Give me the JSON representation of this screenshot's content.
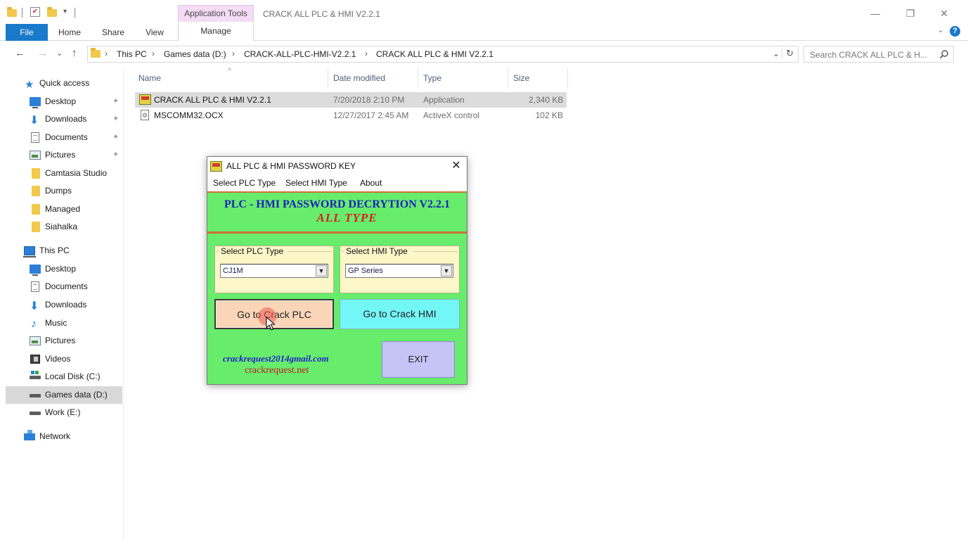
{
  "window": {
    "title": "CRACK ALL PLC & HMI V2.2.1",
    "context_tab": "Application Tools",
    "minimize_glyph": "—",
    "restore_glyph": "❐",
    "close_glyph": "✕"
  },
  "ribbon": {
    "tabs": [
      "File",
      "Home",
      "Share",
      "View",
      "Manage"
    ],
    "help_glyph": "?",
    "expand_glyph": "⌄"
  },
  "nav": {
    "back_glyph": "←",
    "forward_glyph": "→",
    "recent_glyph": "⌄",
    "up_glyph": "↑",
    "breadcrumb": [
      "This PC",
      "Games data (D:)",
      "CRACK-ALL-PLC-HMI-V2.2.1",
      "CRACK ALL PLC & HMI V2.2.1"
    ],
    "chevron": "›",
    "dropdown_glyph": "⌄",
    "refresh_glyph": "↻",
    "search_placeholder": "Search CRACK ALL PLC & H..."
  },
  "sidebar": {
    "quick_access": "Quick access",
    "pin_glyph": "📌",
    "items": [
      {
        "label": "Desktop",
        "icon": "desktop-icon",
        "pinned": true
      },
      {
        "label": "Downloads",
        "icon": "downloads-icon",
        "pinned": true
      },
      {
        "label": "Documents",
        "icon": "documents-icon",
        "pinned": true
      },
      {
        "label": "Pictures",
        "icon": "pictures-icon",
        "pinned": true
      },
      {
        "label": "Camtasia Studio",
        "icon": "folder-icon",
        "pinned": false
      },
      {
        "label": "Dumps",
        "icon": "folder-icon",
        "pinned": false
      },
      {
        "label": "Managed",
        "icon": "folder-icon",
        "pinned": false
      },
      {
        "label": "Siahalka",
        "icon": "folder-icon",
        "pinned": false
      }
    ],
    "this_pc": "This PC",
    "pc_items": [
      {
        "label": "Desktop",
        "icon": "desktop-icon"
      },
      {
        "label": "Documents",
        "icon": "documents-icon"
      },
      {
        "label": "Downloads",
        "icon": "downloads-icon"
      },
      {
        "label": "Music",
        "icon": "music-icon"
      },
      {
        "label": "Pictures",
        "icon": "pictures-icon"
      },
      {
        "label": "Videos",
        "icon": "videos-icon"
      },
      {
        "label": "Local Disk (C:)",
        "icon": "local-disk-icon"
      },
      {
        "label": "Games data (D:)",
        "icon": "drive-icon",
        "selected": true
      },
      {
        "label": "Work (E:)",
        "icon": "drive-icon"
      }
    ],
    "network": "Network"
  },
  "filelist": {
    "columns": [
      "Name",
      "Date modified",
      "Type",
      "Size"
    ],
    "sort_glyph": "^",
    "rows": [
      {
        "name": "CRACK ALL PLC & HMI V2.2.1",
        "date": "7/20/2018 2:10 PM",
        "type": "Application",
        "size": "2,340 KB",
        "selected": true
      },
      {
        "name": "MSCOMM32.OCX",
        "date": "12/27/2017 2:45 AM",
        "type": "ActiveX control",
        "size": "102 KB",
        "selected": false
      }
    ]
  },
  "dialog": {
    "title": "ALL PLC & HMI PASSWORD KEY",
    "close_glyph": "✕",
    "menu": [
      "Select PLC Type",
      "Select HMI Type",
      "About"
    ],
    "banner_line1": "PLC - HMI PASSWORD DECRYTION V2.2.1",
    "banner_line2": "ALL  TYPE",
    "plc_group": {
      "label": "Select PLC Type",
      "value": "CJ1M"
    },
    "hmi_group": {
      "label": "Select HMI Type",
      "value": "GP Series"
    },
    "combo_arrow": "▼",
    "btn_plc": "Go to Crack PLC",
    "btn_hmi": "Go to Crack HMI",
    "btn_exit": "EXIT",
    "email": "crackrequest2014gmail.com",
    "site": "crackrequest.net",
    "colors": {
      "body": "#67ec6c",
      "banner_title": "#1c22b8",
      "banner_sub": "#d81e1e",
      "plc_button": "#fad5b8",
      "hmi_button": "#73f6f6",
      "exit_button": "#c6c3f7"
    }
  }
}
